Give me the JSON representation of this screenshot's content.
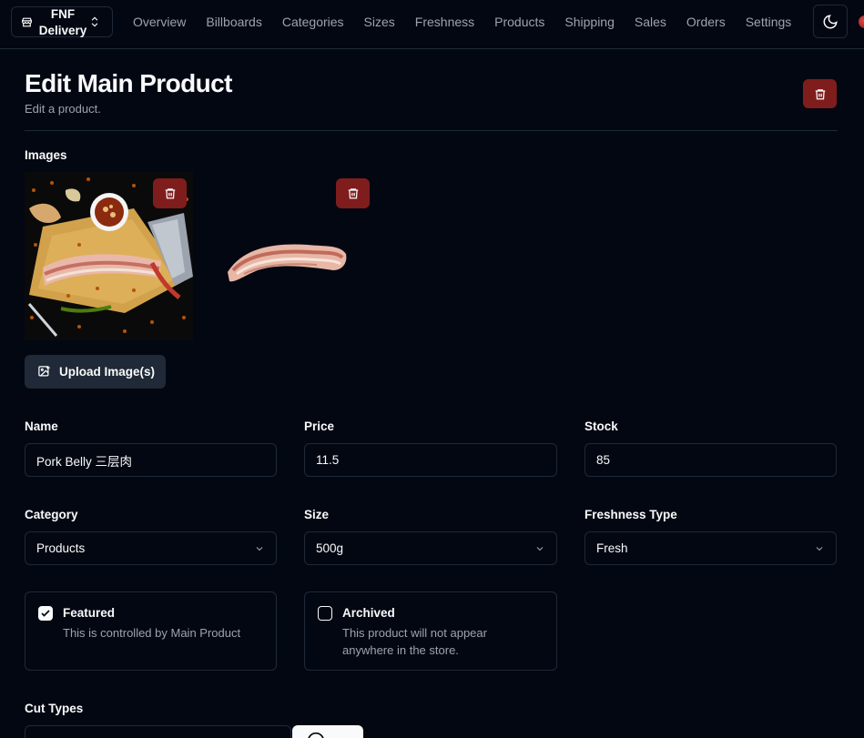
{
  "store": {
    "name": "FNF Delivery",
    "icon": "store-icon"
  },
  "nav": {
    "items": [
      "Overview",
      "Billboards",
      "Categories",
      "Sizes",
      "Freshness",
      "Products",
      "Shipping",
      "Sales",
      "Orders",
      "Settings"
    ]
  },
  "header": {
    "title": "Edit Main Product",
    "subtitle": "Edit a product."
  },
  "images": {
    "label": "Images",
    "upload_label": "Upload Image(s)",
    "count": 2
  },
  "fields": {
    "name": {
      "label": "Name",
      "value": "Pork Belly 三层肉"
    },
    "price": {
      "label": "Price",
      "value": "11.5"
    },
    "stock": {
      "label": "Stock",
      "value": "85"
    },
    "category": {
      "label": "Category",
      "value": "Products"
    },
    "size": {
      "label": "Size",
      "value": "500g"
    },
    "freshness": {
      "label": "Freshness Type",
      "value": "Fresh"
    }
  },
  "featured": {
    "title": "Featured",
    "description": "This is controlled by Main Product",
    "checked": true
  },
  "archived": {
    "title": "Archived",
    "description_line1": "This product will not appear",
    "description_line2": "anywhere in the store.",
    "checked": false
  },
  "cut_types": {
    "label": "Cut Types"
  },
  "colors": {
    "background": "#030712",
    "border": "#1f2937",
    "danger": "#7f1d1d",
    "muted": "#9ca3af"
  }
}
